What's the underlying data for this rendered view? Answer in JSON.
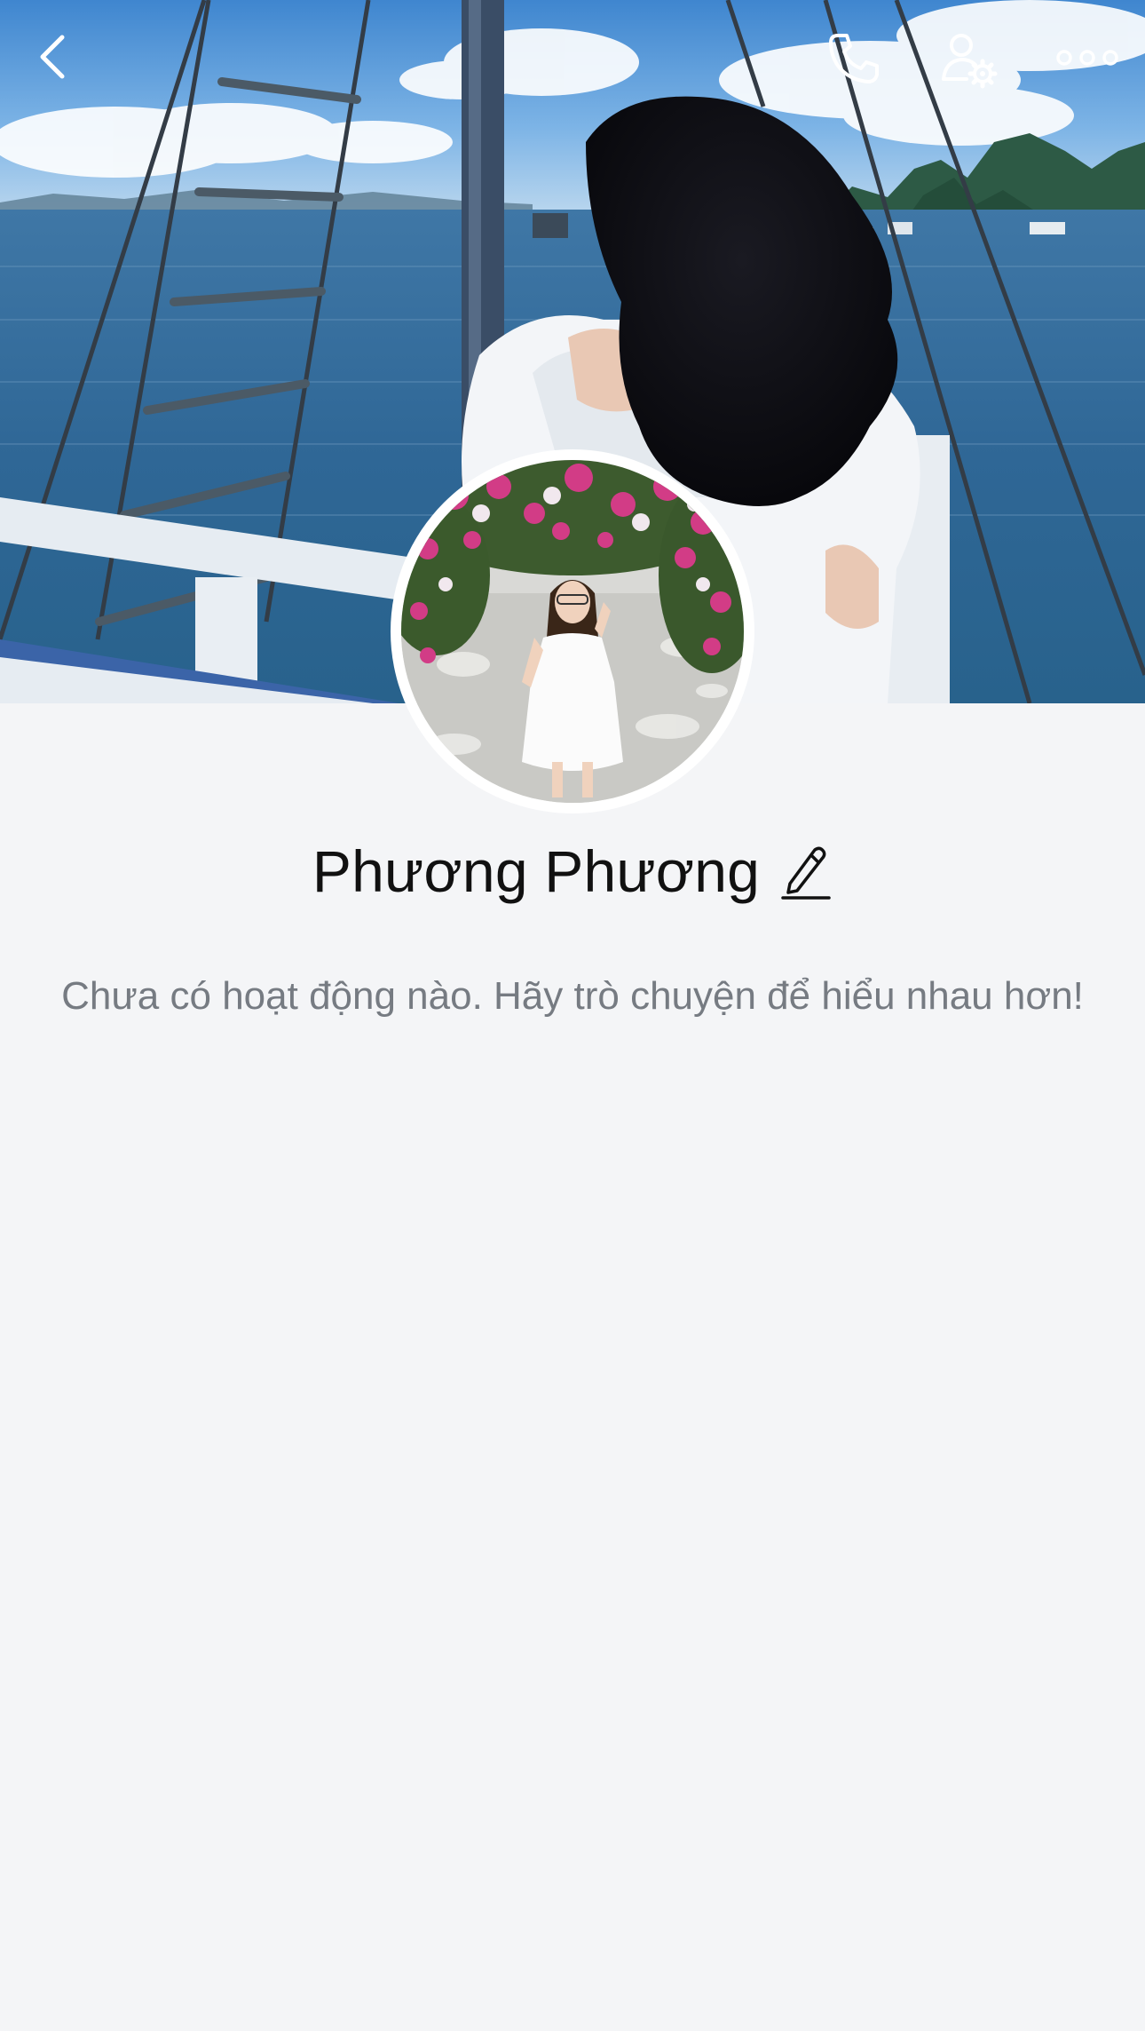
{
  "header": {
    "back_icon": "chevron-left-icon",
    "call_icon": "phone-icon",
    "user_settings_icon": "user-settings-icon",
    "more_icon": "more-horizontal-icon"
  },
  "cover": {
    "description_icon": "cover-photo"
  },
  "profile": {
    "name": "Phương Phương",
    "edit_icon": "pencil-icon"
  },
  "activity": {
    "empty_message": "Chưa có hoạt động nào. Hãy trò chuyện để hiểu nhau hơn!"
  },
  "colors": {
    "background": "#f4f5f7",
    "name_text": "#111111",
    "secondary_text": "#767b82",
    "icon_on_cover": "#ffffff"
  }
}
